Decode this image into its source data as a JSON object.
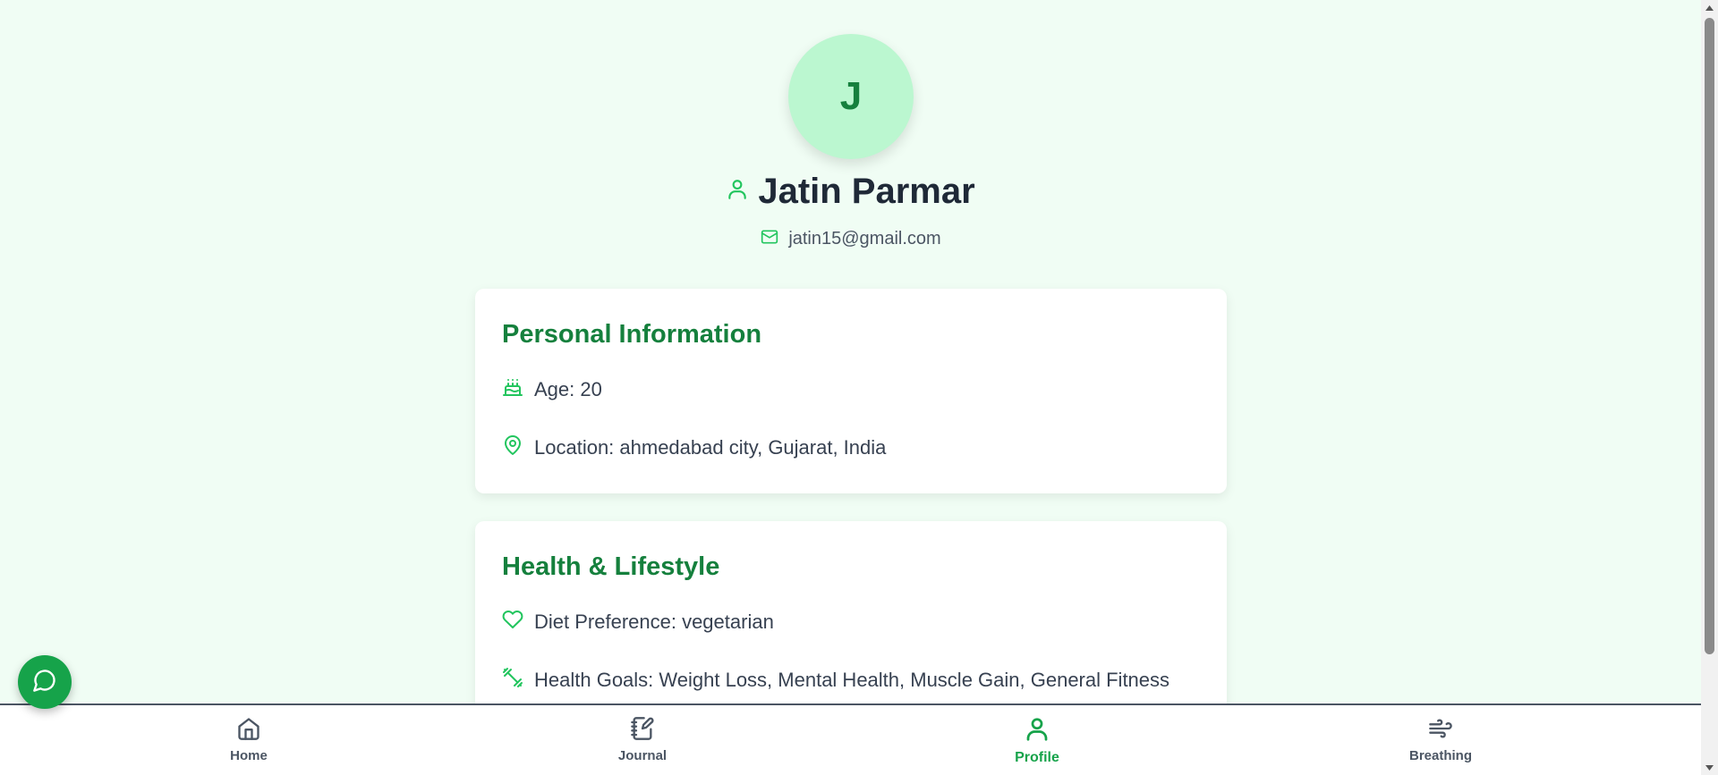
{
  "profile": {
    "initial": "J",
    "name": "Jatin Parmar",
    "email": "jatin15@gmail.com"
  },
  "personal_info": {
    "title": "Personal Information",
    "age": "Age: 20",
    "location": "Location: ahmedabad city, Gujarat, India"
  },
  "health": {
    "title": "Health & Lifestyle",
    "diet": "Diet Preference: vegetarian",
    "goals": "Health Goals: Weight Loss, Mental Health, Muscle Gain, General Fitness"
  },
  "nav": {
    "home": "Home",
    "journal": "Journal",
    "profile": "Profile",
    "breathing": "Breathing",
    "active": "profile"
  },
  "icons": {
    "name": "user-icon",
    "email": "mail-icon",
    "age": "cake-icon",
    "location": "map-pin-icon",
    "diet": "heart-icon",
    "goals": "dumbbell-icon",
    "chat": "message-circle-icon"
  },
  "colors": {
    "background": "#f0fdf4",
    "accent": "#16a34a",
    "heading": "#15803d",
    "avatar_bg": "#bbf7d0"
  }
}
